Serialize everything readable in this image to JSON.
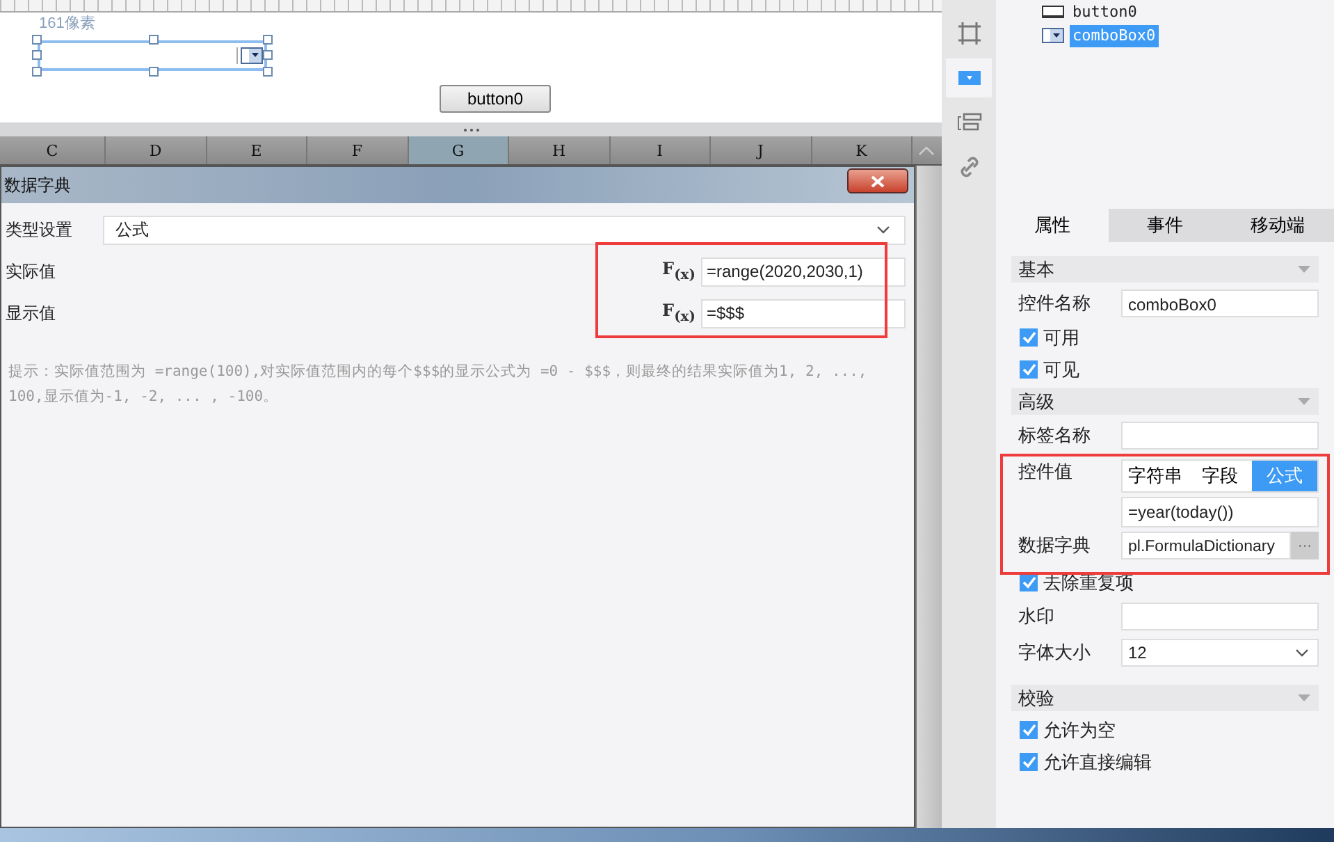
{
  "canvas": {
    "size_label": "161像素",
    "button_label": "button0"
  },
  "sheet_columns": [
    {
      "label": "C",
      "selected": false
    },
    {
      "label": "D",
      "selected": false
    },
    {
      "label": "E",
      "selected": false
    },
    {
      "label": "F",
      "selected": false
    },
    {
      "label": "G",
      "selected": true
    },
    {
      "label": "H",
      "selected": false
    },
    {
      "label": "I",
      "selected": false
    },
    {
      "label": "J",
      "selected": false
    },
    {
      "label": "K",
      "selected": false
    }
  ],
  "dialog": {
    "title": "数据字典",
    "type_label": "类型设置",
    "type_value": "公式",
    "rows": [
      {
        "label": "实际值",
        "fx": "F$_{(x)}$",
        "value": "=range(2020,2030,1)"
      },
      {
        "label": "显示值",
        "fx": "F$_{(x)}$",
        "value": "=$$$"
      }
    ],
    "hint": "提示：实际值范围为 =range(100),对实际值范围内的每个$$$的显示公式为 =0 - $$$，则最终的结果实际值为1, 2, ..., 100,显示值为-1, -2, ... , -100。"
  },
  "side_icons": [
    {
      "kind": "frame",
      "selected": false
    },
    {
      "kind": "combo",
      "selected": true
    },
    {
      "kind": "list",
      "selected": false
    },
    {
      "kind": "link",
      "selected": false
    }
  ],
  "tree": [
    {
      "kind": "button",
      "label": "button0",
      "selected": false
    },
    {
      "kind": "combo",
      "label": "comboBox0",
      "selected": true
    }
  ],
  "tabs": [
    {
      "label": "属性",
      "selected": true
    },
    {
      "label": "事件",
      "selected": false
    },
    {
      "label": "移动端",
      "selected": false
    }
  ],
  "basic": {
    "title": "基本",
    "name_label": "控件名称",
    "name_value": "comboBox0",
    "checks": [
      {
        "label": "可用",
        "checked": true
      },
      {
        "label": "可见",
        "checked": true
      }
    ]
  },
  "advanced": {
    "title": "高级",
    "tag_label": "标签名称",
    "value_label": "控件值",
    "segments": [
      {
        "label": "字符串",
        "selected": false
      },
      {
        "label": "字段",
        "selected": false
      },
      {
        "label": "公式",
        "selected": true
      }
    ],
    "value": "=year(today())",
    "dict_label": "数据字典",
    "dict_value": "pl.FormulaDictionary",
    "dict_button": "···",
    "dedupe": {
      "label": "去除重复项",
      "checked": true
    },
    "watermark_label": "水印",
    "font_label": "字体大小",
    "font_value": "12"
  },
  "validation": {
    "title": "校验",
    "checks": [
      {
        "label": "允许为空",
        "checked": true
      },
      {
        "label": "允许直接编辑",
        "checked": true
      }
    ]
  }
}
